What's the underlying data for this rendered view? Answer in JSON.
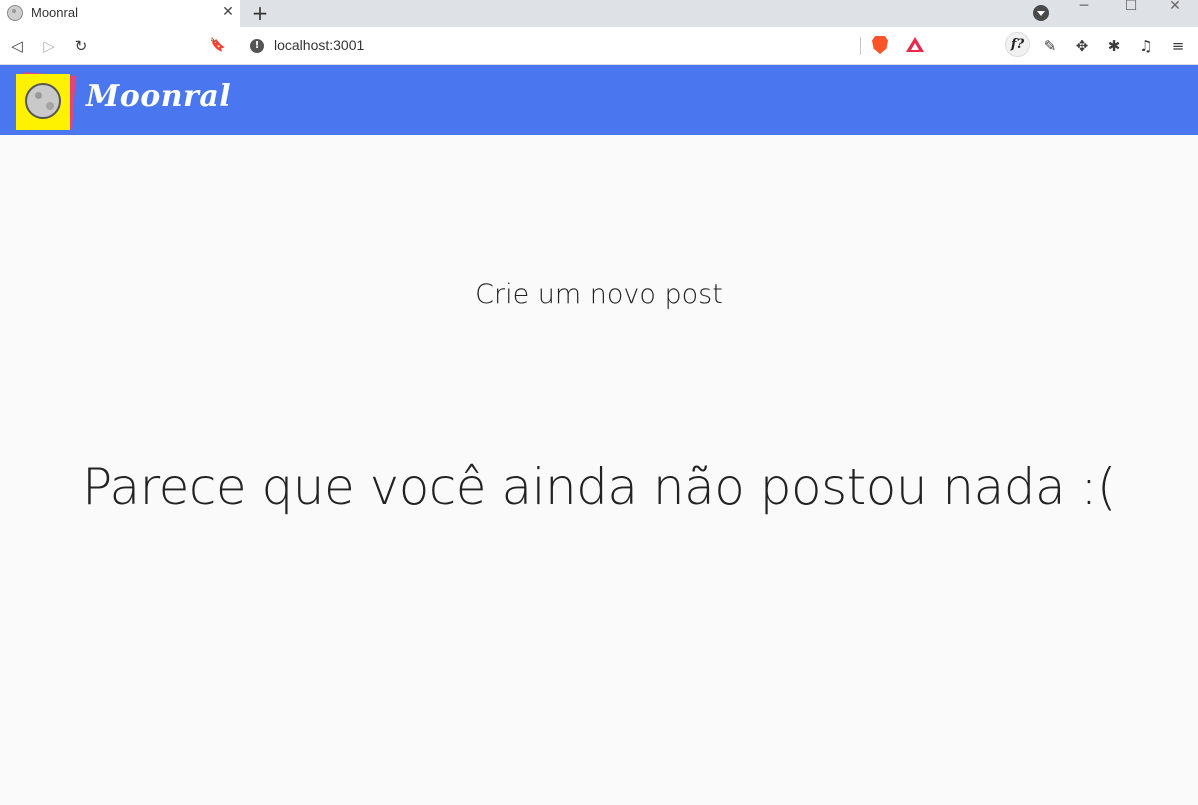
{
  "browser": {
    "tab": {
      "title": "Moonral",
      "close_glyph": "✕"
    },
    "new_tab_glyph": "+",
    "url": "localhost:3001",
    "info_glyph": "!",
    "window_controls": {
      "minimize": "─",
      "maximize": "☐",
      "close": "✕"
    },
    "toolbar_glyphs": {
      "back": "◁",
      "forward": "▷",
      "reload": "↻",
      "bookmark": "🔖",
      "eyedropper": "✎",
      "move": "✥",
      "extensions": "✱",
      "media": "♫",
      "menu": "≡"
    },
    "ext_font_label": "f?"
  },
  "app": {
    "brand": "Moonral",
    "create_post_label": "Crie um novo post",
    "empty_message": "Parece que você ainda não postou nada :(",
    "colors": {
      "header": "#4a77f0",
      "background": "#fafafa",
      "logo_note": "#fff200",
      "logo_note_back": "#e0457b"
    }
  },
  "icons": [
    "moon-favicon-icon",
    "close-icon",
    "plus-icon",
    "search-tabs-icon",
    "back-icon",
    "forward-icon",
    "reload-icon",
    "bookmark-icon",
    "info-icon",
    "brave-shield-icon",
    "bat-rewards-icon",
    "font-finder-icon",
    "eyedropper-icon",
    "move-icon",
    "extensions-icon",
    "media-icon",
    "menu-icon",
    "moon-logo-icon"
  ]
}
